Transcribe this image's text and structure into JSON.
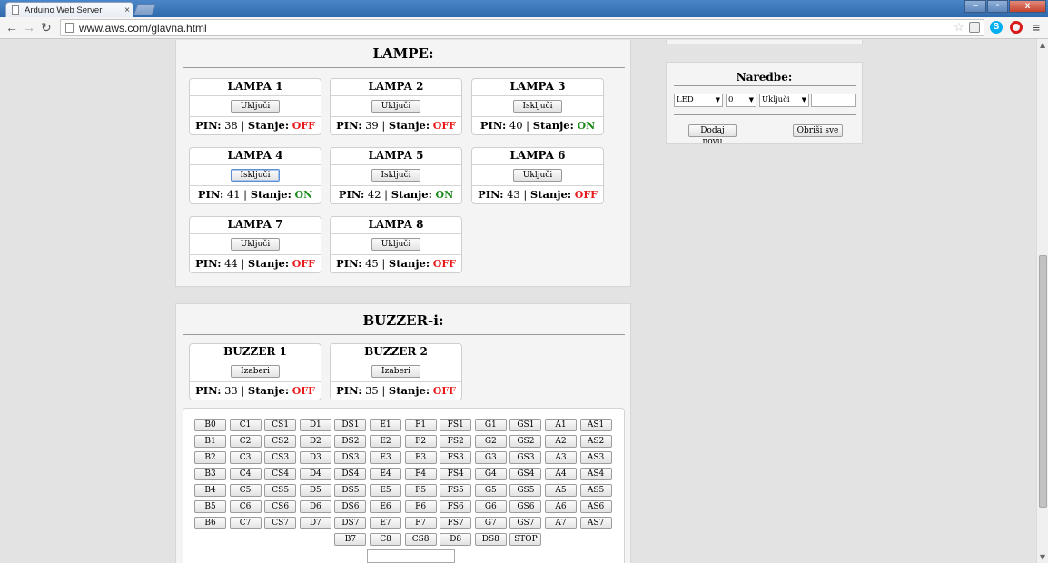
{
  "window": {
    "tab_title": "Arduino Web Server",
    "tab_close": "×",
    "min": "–",
    "max": "▫",
    "close": "x"
  },
  "toolbar": {
    "url": "www.aws.com/glavna.html",
    "back": "←",
    "forward": "→",
    "reload": "↻",
    "star": "☆",
    "menu": "≡",
    "skype": "S"
  },
  "lampe": {
    "title": "LAMPE:",
    "pin_label": "PIN:",
    "stanje_label": "Stanje:",
    "cards": [
      {
        "name": "LAMPA 1",
        "button": "Uključi",
        "pin": "38",
        "state": "OFF"
      },
      {
        "name": "LAMPA 2",
        "button": "Uključi",
        "pin": "39",
        "state": "OFF"
      },
      {
        "name": "LAMPA 3",
        "button": "Isključi",
        "pin": "40",
        "state": "ON"
      },
      {
        "name": "LAMPA 4",
        "button": "Isključi",
        "pin": "41",
        "state": "ON"
      },
      {
        "name": "LAMPA 5",
        "button": "Isključi",
        "pin": "42",
        "state": "ON"
      },
      {
        "name": "LAMPA 6",
        "button": "Uključi",
        "pin": "43",
        "state": "OFF"
      },
      {
        "name": "LAMPA 7",
        "button": "Uključi",
        "pin": "44",
        "state": "OFF"
      },
      {
        "name": "LAMPA 8",
        "button": "Uključi",
        "pin": "45",
        "state": "OFF"
      }
    ]
  },
  "buzzers": {
    "title": "BUZZER-i:",
    "cards": [
      {
        "name": "BUZZER 1",
        "button": "Izaberi",
        "pin": "33",
        "state": "OFF"
      },
      {
        "name": "BUZZER 2",
        "button": "Izaberi",
        "pin": "35",
        "state": "OFF"
      }
    ],
    "notes": [
      [
        "B0",
        "C1",
        "CS1",
        "D1",
        "DS1",
        "E1",
        "F1",
        "FS1",
        "G1",
        "GS1",
        "A1",
        "AS1"
      ],
      [
        "B1",
        "C2",
        "CS2",
        "D2",
        "DS2",
        "E2",
        "F2",
        "FS2",
        "G2",
        "GS2",
        "A2",
        "AS2"
      ],
      [
        "B2",
        "C3",
        "CS3",
        "D3",
        "DS3",
        "E3",
        "F3",
        "FS3",
        "G3",
        "GS3",
        "A3",
        "AS3"
      ],
      [
        "B3",
        "C4",
        "CS4",
        "D4",
        "DS4",
        "E4",
        "F4",
        "FS4",
        "G4",
        "GS4",
        "A4",
        "AS4"
      ],
      [
        "B4",
        "C5",
        "CS5",
        "D5",
        "DS5",
        "E5",
        "F5",
        "FS5",
        "G5",
        "GS5",
        "A5",
        "AS5"
      ],
      [
        "B5",
        "C6",
        "CS6",
        "D6",
        "DS6",
        "E6",
        "F6",
        "FS6",
        "G6",
        "GS6",
        "A6",
        "AS6"
      ],
      [
        "B6",
        "C7",
        "CS7",
        "D7",
        "DS7",
        "E7",
        "F7",
        "FS7",
        "G7",
        "GS7",
        "A7",
        "AS7"
      ],
      [
        "B7",
        "C8",
        "CS8",
        "D8",
        "DS8",
        "STOP"
      ]
    ],
    "note_input_value": ""
  },
  "naredbe": {
    "title": "Naredbe:",
    "device_select": "LED",
    "number_select": "0",
    "action_select": "Uključi",
    "value_input": "",
    "add_button": "Dodaj novu",
    "clear_button": "Obriši sve"
  },
  "colors": {
    "on": "#1b8c1b",
    "off": "#e81a1a",
    "focus": "#5b8fd0"
  }
}
